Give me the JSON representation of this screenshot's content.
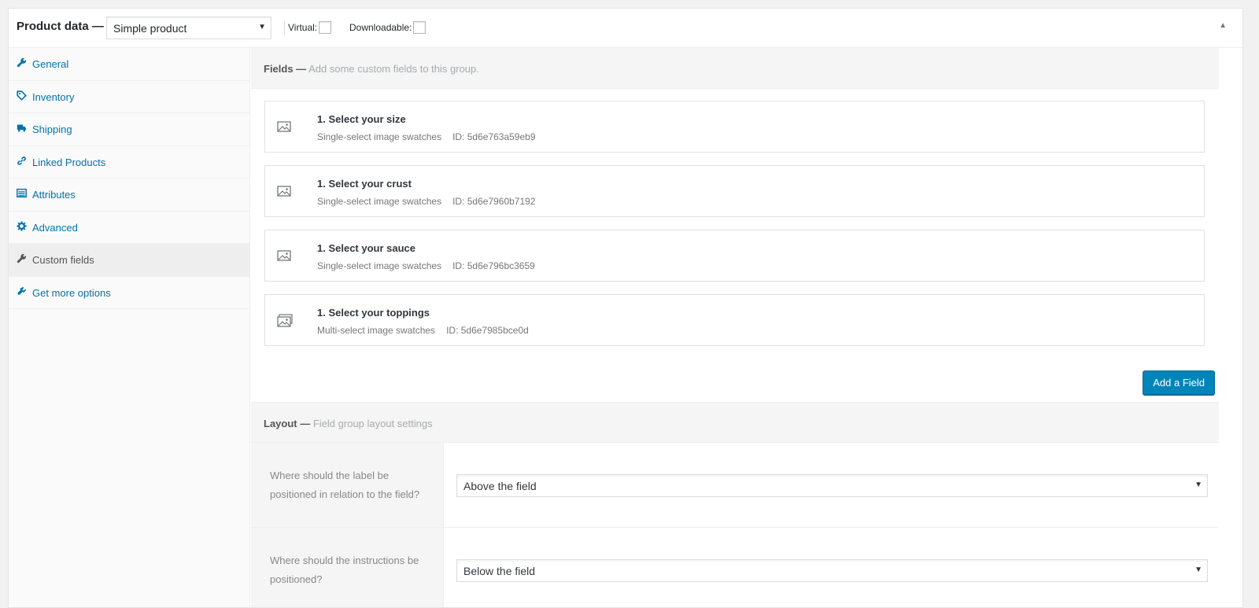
{
  "header": {
    "title": "Product data —",
    "product_type": "Simple product",
    "virtual_label": "Virtual:",
    "downloadable_label": "Downloadable:"
  },
  "sidebar": {
    "items": [
      {
        "label": "General",
        "icon": "wrench-icon"
      },
      {
        "label": "Inventory",
        "icon": "tag-icon"
      },
      {
        "label": "Shipping",
        "icon": "truck-icon"
      },
      {
        "label": "Linked Products",
        "icon": "link-icon"
      },
      {
        "label": "Attributes",
        "icon": "list-icon"
      },
      {
        "label": "Advanced",
        "icon": "gear-icon"
      },
      {
        "label": "Custom fields",
        "icon": "wrench-icon",
        "active": true
      },
      {
        "label": "Get more options",
        "icon": "plugin-icon"
      }
    ]
  },
  "fields_section": {
    "title": "Fields —",
    "subtitle": "Add some custom fields to this group.",
    "fields": [
      {
        "name": "1. Select your size",
        "type": "Single-select image swatches",
        "id": "ID: 5d6e763a59eb9"
      },
      {
        "name": "1. Select your crust",
        "type": "Single-select image swatches",
        "id": "ID: 5d6e7960b7192"
      },
      {
        "name": "1. Select your sauce",
        "type": "Single-select image swatches",
        "id": "ID: 5d6e796bc3659"
      },
      {
        "name": "1. Select your toppings",
        "type": "Multi-select image swatches",
        "id": "ID: 5d6e7985bce0d"
      }
    ],
    "add_button": "Add a Field"
  },
  "layout_section": {
    "title": "Layout —",
    "subtitle": "Field group layout settings",
    "rows": [
      {
        "question": "Where should the label be positioned in relation to the field?",
        "value": "Above the field"
      },
      {
        "question": "Where should the instructions be positioned?",
        "value": "Below the field"
      }
    ]
  },
  "colors": {
    "link": "#0073aa",
    "button": "#0085ba"
  }
}
